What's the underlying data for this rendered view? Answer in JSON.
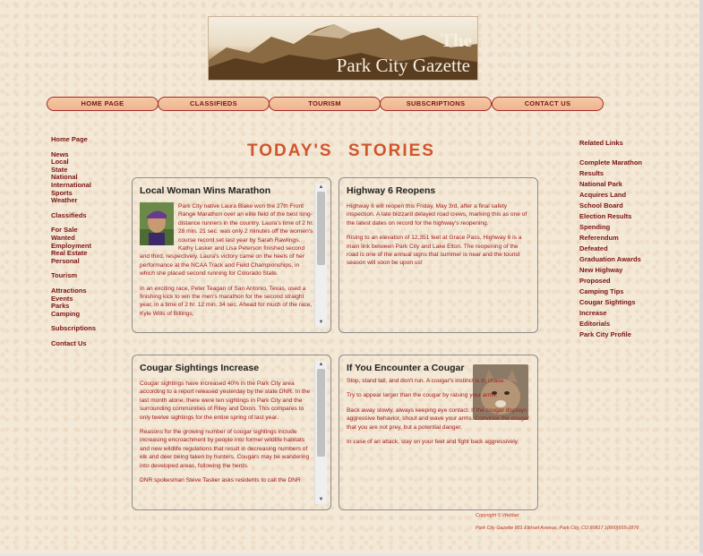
{
  "banner": {
    "the": "The",
    "title": "Park City Gazette"
  },
  "nav": {
    "items": [
      "HOME PAGE",
      "CLASSIFIEDS",
      "TOURISM",
      "SUBSCRIPTIONS",
      "CONTACT US"
    ]
  },
  "left_nav": {
    "home": "Home Page",
    "news": [
      "News",
      "Local",
      "State",
      "National",
      "International",
      "Sports",
      "Weather"
    ],
    "classifieds": "Classifieds",
    "classifieds_items": [
      "For Sale",
      "Wanted",
      "Employment",
      "Real Estate",
      "Personal"
    ],
    "tourism": "Tourism",
    "tourism_items": [
      "Attractions",
      "Events",
      "Parks",
      "Camping"
    ],
    "subscriptions": "Subscriptions",
    "contact": "Contact Us"
  },
  "main": {
    "heading": "TODAY'S STORIES"
  },
  "stories": {
    "marathon": {
      "title": "Local Woman Wins Marathon",
      "p1": "Park City native Laura Blake won the 27th Front Range Marathon over an elite field of the best long-distance runners in the country. Laura's time of 2 hr. 28 min. 21 sec. was only 2 minutes off the women's course record set last year by Sarah Rawlings. Kathy Lasker and Lisa Peterson finished second and third, respectively. Laura's victory came on the heels of her performance at the NCAA Track and Field Championships, in which she placed second running for Colorado State.",
      "p2": "In an exciting race, Peter Teagan of San Antonio, Texas, used a finishing kick to win the men's marathon for the second straight year, in a time of 2 hr. 12 min. 34 sec. Ahead for much of the race, Kyle Wills of Billings,"
    },
    "highway": {
      "title": "Highway 6 Reopens",
      "p1": "Highway 6 will reopen this Friday, May 3rd, after a final safety inspection. A late blizzard delayed road crews, marking this as one of the latest dates on record for the highway's reopening.",
      "p2": "Rising to an elevation of 12,351 feet at Grace Pass, Highway 6 is a main link between Park City and Lake Elton. The reopening of the road is one of the annual signs that summer is near and the tourist season will soon be upon us!"
    },
    "cougar": {
      "title": "Cougar Sightings Increase",
      "p1": "Cougar sightings have increased 40% in the Park City area according to a report released yesterday by the state DNR. In the last month alone, there were ten sightings in Park City and the surrounding communities of Riley and Dixon. This compares to only twelve sightings for the entire spring of last year.",
      "p2": "Reasons for the growing number of cougar sightings include increasing encroachment by people into former wildlife habitats and new wildlife regulations that result in decreasing numbers of elk and deer being taken by hunters. Cougars may be wandering into developed areas, following the herds.",
      "p3": "DNR spokesman Steve Tasker asks residents to call the DNR"
    },
    "encounter": {
      "title": "If You Encounter a Cougar",
      "p1": "Stop, stand tall, and don't run. A cougar's instinct is to chase.",
      "p2": "Try to appear larger than the cougar by raising your arms.",
      "p3": "Back away slowly, always keeping eye contact. If the cougar displays aggressive behavior, shout and wave your arms. Convince the cougar that you are not prey, but a potential danger.",
      "p4": "In case of an attack, stay on your feet and fight back aggressively."
    }
  },
  "right_nav": {
    "title": "Related Links",
    "links": [
      "Complete Marathon",
      "Results",
      "National Park",
      "Acquires Land",
      "School Board",
      "Election Results",
      "Spending",
      "Referendum",
      "Defeated",
      "Graduation Awards",
      "New Highway",
      "Proposed",
      "Camping Tips",
      "Cougar Sightings",
      "Increase",
      "Editorials",
      "Park City Profile"
    ]
  },
  "footer": {
    "copyright": "Copyright © Webber",
    "address": "Park City Gazette 801 Elkhart Avenue, Park City, CO 80817 1(800)555-2876"
  },
  "colors": {
    "accent": "#7a1414",
    "heading": "#d0552b",
    "story_text": "#a21c1c",
    "background": "#f4e8d6"
  }
}
